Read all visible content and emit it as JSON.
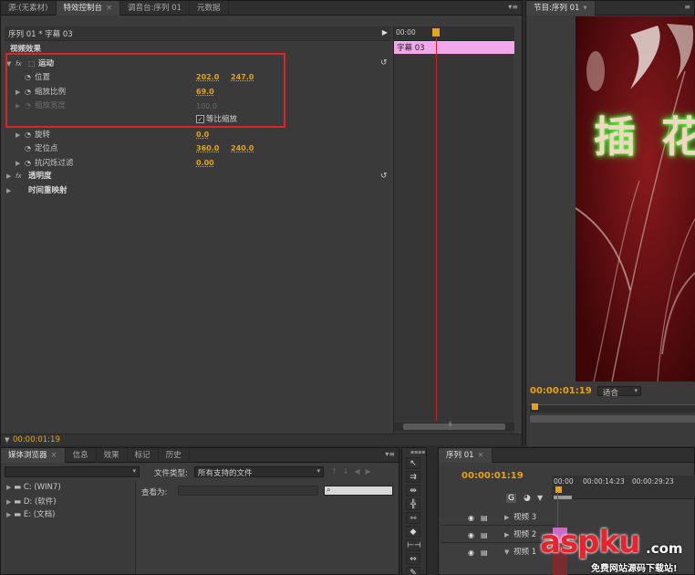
{
  "effect_panel": {
    "tabs": [
      {
        "label": "源:(无素材)"
      },
      {
        "label": "特效控制台"
      },
      {
        "label": "调音台:序列 01"
      },
      {
        "label": "元数据"
      }
    ],
    "sequence_header": "序列 01 * 字幕 03",
    "section_video": "视频效果",
    "motion": {
      "label": "运动",
      "position_label": "位置",
      "position_x": "202.0",
      "position_y": "247.0",
      "scale_label": "缩放比例",
      "scale_value": "69.0",
      "scale_width_label": "缩放宽度",
      "scale_width_value": "100.0",
      "uniform_label": "等比缩放",
      "uniform_check": "✓",
      "rotation_label": "旋转",
      "rotation_value": "0.0",
      "anchor_label": "定位点",
      "anchor_x": "360.0",
      "anchor_y": "240.0",
      "antiflicker_label": "抗闪烁过滤",
      "antiflicker_value": "0.00"
    },
    "opacity_label": "透明度",
    "time_remap_label": "时间重映射",
    "timeline_start": "00:00",
    "clip_label": "字幕 03",
    "timecode": "00:00:01:19",
    "scroll_grip": "⦀"
  },
  "program_monitor": {
    "tab_label": "节目:序列 01",
    "timecode": "00:00:01:19",
    "fit_label": "适合",
    "title_text": "插 花"
  },
  "media_browser": {
    "tabs": [
      {
        "label": "媒体浏览器"
      },
      {
        "label": "信息"
      },
      {
        "label": "效果"
      },
      {
        "label": "标记"
      },
      {
        "label": "历史"
      }
    ],
    "file_type_label": "文件类型:",
    "file_type_value": "所有支持的文件",
    "view_as_label": "查看为:",
    "drives": [
      {
        "label": "C: (WIN7)"
      },
      {
        "label": "D: (软件)"
      },
      {
        "label": "E: (文档)"
      }
    ]
  },
  "timeline": {
    "tab_label": "序列 01",
    "timecode": "00:00:01:19",
    "ruler": [
      "00:00",
      "00:00:14:23",
      "00:00:29:23"
    ],
    "tracks": [
      {
        "label": "视频 3"
      },
      {
        "label": "视频 2"
      },
      {
        "label": "视频 1"
      }
    ]
  },
  "watermark": {
    "main": "aspku",
    "suffix": ".com",
    "sub": "免费网站源码下载站!"
  },
  "colors": {
    "accent_orange": "#e8a21a",
    "highlight_red": "#d8262d",
    "clip_pink": "#f4a8ec",
    "playhead_red": "#c8252a"
  }
}
